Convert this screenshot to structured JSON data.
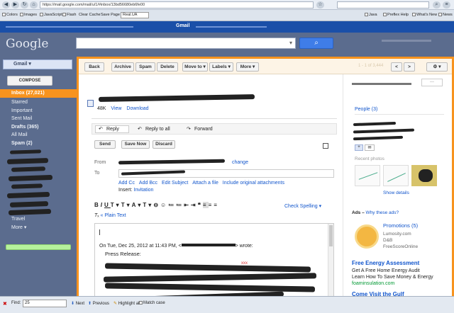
{
  "browser": {
    "url": "https://mail.google.com/mail/u/1/#inbox/13bd56680eb6fe00",
    "toolbar": {
      "colors": "Colors",
      "images": "Images",
      "javascript": "JavaScript",
      "flash": "Flash",
      "clear_cache": "Clear Cache",
      "save_page": "Save Page",
      "save_value": "Real.UA",
      "java": "Java",
      "preflex": "Preflex Help",
      "whats_new": "What's New",
      "news": "News"
    }
  },
  "gbar": {
    "title": "Gmail"
  },
  "header": {
    "logo": "Google"
  },
  "sidebar": {
    "gmail_label": "Gmail",
    "compose": "COMPOSE",
    "inbox": "Inbox (27,021)",
    "items": [
      {
        "label": "Starred",
        "bold": false
      },
      {
        "label": "Important",
        "bold": false
      },
      {
        "label": "Sent Mail",
        "bold": false
      },
      {
        "label": "Drafts (365)",
        "bold": true
      },
      {
        "label": "All Mail",
        "bold": false
      },
      {
        "label": "Spam (2)",
        "bold": true
      }
    ],
    "travel": "Travel",
    "more": "More"
  },
  "actions": {
    "back": "Back",
    "archive": "Archive",
    "spam": "Spam",
    "delete": "Delete",
    "move_to": "Move to",
    "labels": "Labels",
    "more": "More",
    "pagination": "1 - 1 of 3,444"
  },
  "message": {
    "attachment_size": "48K",
    "view": "View",
    "download": "Download",
    "reply": "Reply",
    "reply_all": "Reply to all",
    "forward": "Forward",
    "send": "Send",
    "save_now": "Save Now",
    "discard": "Discard",
    "from_label": "From",
    "change": "change",
    "to_label": "To",
    "add_cc": "Add Cc",
    "add_bcc": "Add Bcc",
    "edit_subject": "Edit Subject",
    "attach_file": "Attach a file",
    "include_attachments": "Include original attachments",
    "insert_label": "Insert:",
    "invitation": "Invitation",
    "check_spelling": "Check Spelling",
    "plain_text": "« Plain Text",
    "quote_header_prefix": "On Tue, Dec 25, 2012 at 11:43 PM, <",
    "quote_header_suffix": "> wrote:",
    "press_release": "Press Release:"
  },
  "right_panel": {
    "people": "People (3)",
    "recent_photos": "Recent photos",
    "show_details": "Show details",
    "ads_label": "Ads –",
    "why_ads": "Why these ads?",
    "promotions": "Promotions (5)",
    "lumosity": "Lumosity.com",
    "db": "D&B",
    "freescore": "FreeScoreOnline",
    "ad1_title": "Free Energy Assessment",
    "ad1_line1": "Get A Free Home Energy Audit",
    "ad1_line2": "Learn How To Save Money & Energy",
    "ad1_url": "foaminsulation.com",
    "ad2_title": "Come Visit the Gulf"
  },
  "findbar": {
    "find_label": "Find:",
    "find_value": "25",
    "next": "Next",
    "previous": "Previous",
    "highlight": "Highlight all",
    "match_case": "Match case"
  }
}
